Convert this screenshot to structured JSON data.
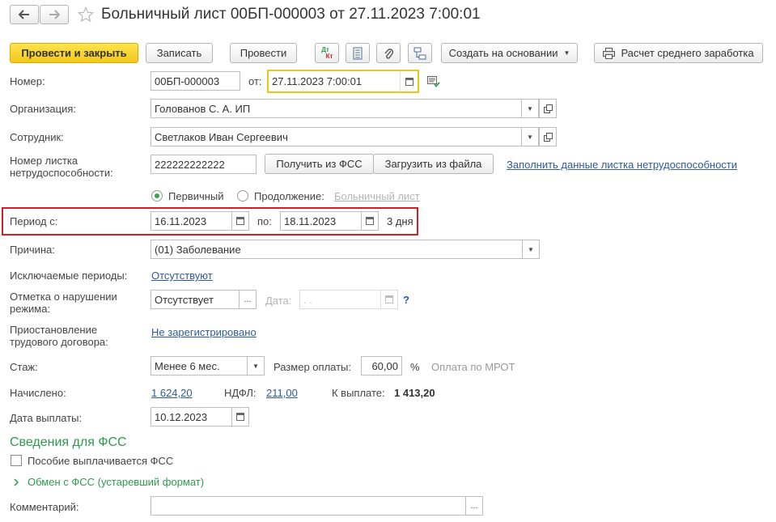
{
  "header": {
    "title": "Больничный лист 00БП-000003 от 27.11.2023 7:00:01",
    "back_icon": "arrow-left-icon",
    "forward_icon": "arrow-right-icon",
    "star_icon": "star-icon"
  },
  "toolbar": {
    "post_close": "Провести и закрыть",
    "save": "Записать",
    "post": "Провести",
    "dtkt_top": "Дт",
    "dtkt_bottom": "Кт",
    "create_based": "Создать на основании",
    "avg_earnings": "Расчет среднего заработка"
  },
  "form": {
    "number_label": "Номер:",
    "number_value": "00БП-000003",
    "from_label": "от:",
    "date_value": "27.11.2023  7:00:01",
    "org_label": "Организация:",
    "org_value": "Голованов С. А. ИП",
    "employee_label": "Сотрудник:",
    "employee_value": "Светлаков Иван Сергеевич",
    "sheet_label_1": "Номер листка",
    "sheet_label_2": "нетрудоспособности:",
    "sheet_value": "222222222222",
    "get_fss": "Получить из ФСС",
    "load_file": "Загрузить из файла",
    "fill_link": "Заполнить данные листка нетрудоспособности",
    "primary_label": "Первичный",
    "continuation_label": "Продолжение:",
    "sick_link": "Больничный лист",
    "period_label": "Период с:",
    "period_from": "16.11.2023",
    "to_label": "по:",
    "period_to": "18.11.2023",
    "days": "3 дня",
    "reason_label": "Причина:",
    "reason_value": "(01) Заболевание",
    "excluded_label": "Исключаемые периоды:",
    "excluded_link": "Отсутствуют",
    "violation_label_1": "Отметка о нарушении",
    "violation_label_2": "режима:",
    "violation_value": "Отсутствует",
    "ellipsis": "...",
    "date_label": "Дата:",
    "date_empty": " .  .",
    "question": "?",
    "suspend_label_1": "Приостановление",
    "suspend_label_2": "трудового договора:",
    "suspend_link": "Не зарегистрировано",
    "experience_label": "Стаж:",
    "experience_value": "Менее 6 мес.",
    "payment_size_label": "Размер оплаты:",
    "payment_size_value": "60,00",
    "percent": "%",
    "mrot_note": "Оплата по МРОТ",
    "accrued_label": "Начислено:",
    "accrued_value": "1 624,20",
    "ndfl_label": "НДФЛ:",
    "ndfl_value": "211,00",
    "payout_label": "К выплате:",
    "payout_value": "1 413,20",
    "pay_date_label": "Дата выплаты:",
    "pay_date_value": "10.12.2023",
    "fss_section": "Сведения для ФСС",
    "fss_checkbox": "Пособие выплачивается ФСС",
    "fss_exchange": "Обмен с ФСС (устаревший формат)",
    "comment_label": "Комментарий:",
    "comment_value": ""
  },
  "colors": {
    "primary_button": "#f2c81d",
    "link": "#2d5b9b",
    "section_green": "#2e9a4c",
    "highlight_red": "#d0202a",
    "focus_yellow": "#f0c419"
  }
}
